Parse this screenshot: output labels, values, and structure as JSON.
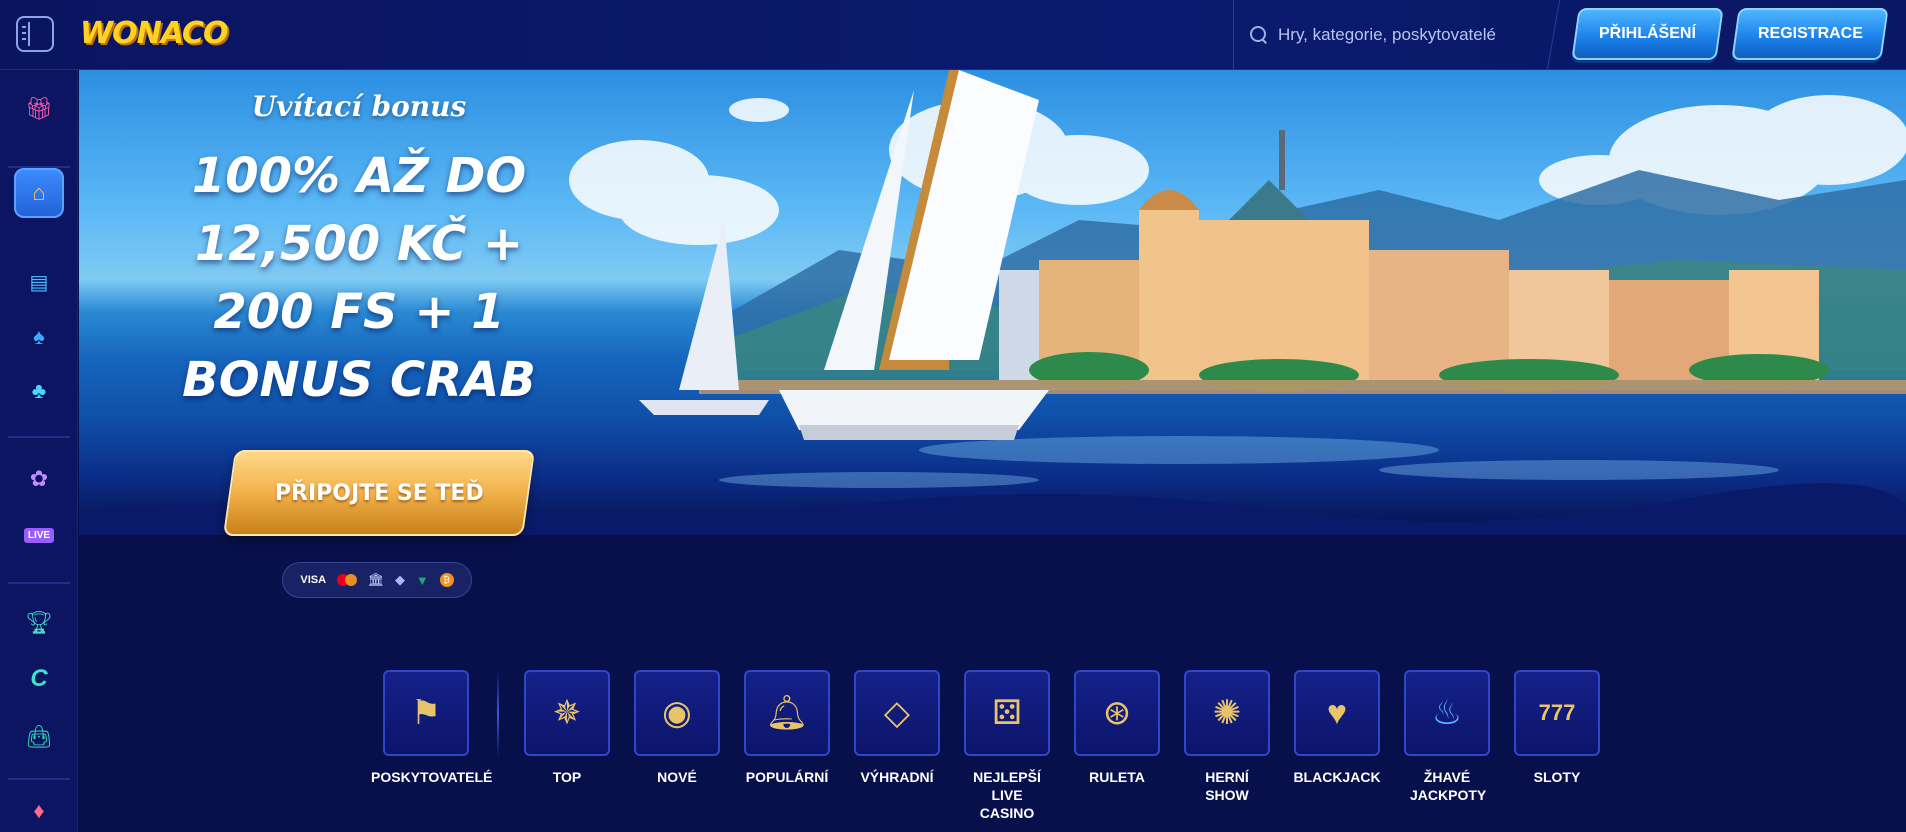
{
  "header": {
    "logo": "WONACO",
    "search_placeholder": "Hry, kategorie, poskytovatelé",
    "login_label": "PŘIHLÁŠENÍ",
    "register_label": "REGISTRACE"
  },
  "sidebar": {
    "items": [
      {
        "name": "gift-icon"
      },
      {
        "name": "home-icon"
      },
      {
        "name": "slot-machine-icon"
      },
      {
        "name": "card-icon"
      },
      {
        "name": "clover-icon"
      },
      {
        "name": "poker-chip-icon"
      },
      {
        "name": "live-icon",
        "label": "LIVE"
      },
      {
        "name": "trophy-icon"
      },
      {
        "name": "crab-c-icon"
      },
      {
        "name": "shopping-bag-icon"
      },
      {
        "name": "gem-icon"
      }
    ]
  },
  "hero": {
    "subtitle": "Uvítací bonus",
    "title": "100% AŽ DO 12,500 KČ + 200 FS + 1 BONUS CRAB",
    "cta_label": "PŘIPOJTE SE TEĎ",
    "payments": {
      "visa": "VISA",
      "btc": "₿"
    }
  },
  "categories": [
    {
      "label": "POSKYTOVATELÉ",
      "icon": "providers-icon"
    },
    {
      "label": "TOP",
      "icon": "compass-star-icon"
    },
    {
      "label": "NOVÉ",
      "icon": "chip-icon"
    },
    {
      "label": "POPULÁRNÍ",
      "icon": "bell-icon"
    },
    {
      "label": "VÝHRADNÍ",
      "icon": "diamond-icon"
    },
    {
      "label": "NEJLEPŠÍ LIVE CASINO",
      "icon": "dice-chip-icon"
    },
    {
      "label": "RULETA",
      "icon": "roulette-icon"
    },
    {
      "label": "HERNÍ SHOW",
      "icon": "wheel-icon"
    },
    {
      "label": "BLACKJACK",
      "icon": "cards-icon"
    },
    {
      "label": "ŽHAVÉ JACKPOTY",
      "icon": "flame-icon"
    },
    {
      "label": "SLOTY",
      "icon": "slots-777-icon"
    }
  ],
  "colors": {
    "background": "#07104a",
    "accent_blue": "#1a7fe8",
    "cta_gold": "#f2b14a",
    "logo_yellow": "#ffd21f"
  }
}
